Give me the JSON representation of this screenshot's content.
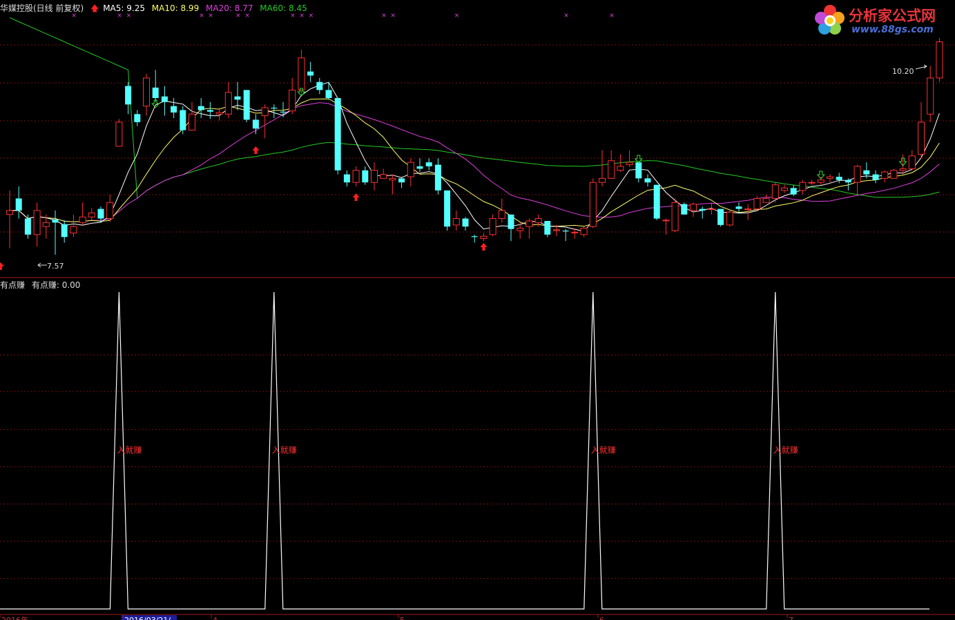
{
  "header": {
    "title": "华媒控股(日线 前复权)",
    "ma5": "MA5: 9.25",
    "ma10": "MA10: 8.99",
    "ma20": "MA20: 8.77",
    "ma60": "MA60: 8.45",
    "ma5_color": "#ffffff",
    "ma10_color": "#ffff66",
    "ma20_color": "#e040e0",
    "ma60_color": "#22cc22"
  },
  "sub_header": {
    "indicator": "有点赚",
    "value": "有点赚: 0.00"
  },
  "logo": {
    "text": "分析家公式网",
    "url": "www.88gs.com"
  },
  "annotations": {
    "high_label": "10.20",
    "low_label": "7.57",
    "signal_label": "入就赚"
  },
  "axis": {
    "labels": [
      "2016年",
      "2016/03/21/-",
      "4",
      "5",
      "6",
      "7"
    ]
  },
  "chart_data": [
    {
      "type": "candlestick",
      "title": "华媒控股(日线 前复权)",
      "ylim": [
        7.3,
        10.6
      ],
      "up_color": "#ff3030",
      "down_color": "#54ffff",
      "candles": [
        [
          8.05,
          8.1,
          8.35,
          7.63
        ],
        [
          8.25,
          8.1,
          8.4,
          8.0
        ],
        [
          8.0,
          7.8,
          8.05,
          7.75
        ],
        [
          7.8,
          8.1,
          8.2,
          7.65
        ],
        [
          7.9,
          7.95,
          8.05,
          7.75
        ],
        [
          7.99,
          7.95,
          8.1,
          7.55
        ],
        [
          7.93,
          7.77,
          7.98,
          7.7
        ],
        [
          7.82,
          7.9,
          8.05,
          7.77
        ],
        [
          7.95,
          8.02,
          8.2,
          7.92
        ],
        [
          8.02,
          8.07,
          8.13,
          7.98
        ],
        [
          8.12,
          8.0,
          8.15,
          7.95
        ],
        [
          8.0,
          8.2,
          8.3,
          7.96
        ],
        [
          8.9,
          9.2,
          9.24,
          8.9
        ],
        [
          9.65,
          9.42,
          9.7,
          9.3
        ],
        [
          9.3,
          9.2,
          9.35,
          9.15
        ],
        [
          9.4,
          9.75,
          9.8,
          9.28
        ],
        [
          9.63,
          9.5,
          9.85,
          9.45
        ],
        [
          9.52,
          9.45,
          9.65,
          9.28
        ],
        [
          9.4,
          9.32,
          9.5,
          9.25
        ],
        [
          9.35,
          9.1,
          9.4,
          9.05
        ],
        [
          9.1,
          9.3,
          9.45,
          9.1
        ],
        [
          9.4,
          9.35,
          9.5,
          9.25
        ],
        [
          9.35,
          9.33,
          9.45,
          9.24
        ],
        [
          9.3,
          9.32,
          9.38,
          9.22
        ],
        [
          9.3,
          9.57,
          9.7,
          9.25
        ],
        [
          9.52,
          9.48,
          9.7,
          9.35
        ],
        [
          9.6,
          9.23,
          9.6,
          9.2
        ],
        [
          9.23,
          9.12,
          9.3,
          9.05
        ],
        [
          9.28,
          9.38,
          9.42,
          9.0
        ],
        [
          9.38,
          9.37,
          9.42,
          9.25
        ],
        [
          9.33,
          9.32,
          9.45,
          9.26
        ],
        [
          9.34,
          9.6,
          9.75,
          9.3
        ],
        [
          9.6,
          10.0,
          10.1,
          9.55
        ],
        [
          9.83,
          9.78,
          9.95,
          9.7
        ],
        [
          9.7,
          9.6,
          9.75,
          9.55
        ],
        [
          9.6,
          9.5,
          9.7,
          9.48
        ],
        [
          9.5,
          8.6,
          9.5,
          8.55
        ],
        [
          8.55,
          8.45,
          8.6,
          8.4
        ],
        [
          8.45,
          8.6,
          8.65,
          8.4
        ],
        [
          8.6,
          8.45,
          8.65,
          8.42
        ],
        [
          8.45,
          8.6,
          8.7,
          8.35
        ],
        [
          8.5,
          8.55,
          8.62,
          8.5
        ],
        [
          8.48,
          8.5,
          8.55,
          8.3
        ],
        [
          8.5,
          8.45,
          8.52,
          8.38
        ],
        [
          8.52,
          8.7,
          8.75,
          8.4
        ],
        [
          8.65,
          8.62,
          8.75,
          8.58
        ],
        [
          8.7,
          8.65,
          8.75,
          8.6
        ],
        [
          8.67,
          8.35,
          8.75,
          8.3
        ],
        [
          8.35,
          7.9,
          8.35,
          7.85
        ],
        [
          7.92,
          8.0,
          8.1,
          7.85
        ],
        [
          8.0,
          7.9,
          8.02,
          7.85
        ],
        [
          7.78,
          7.77,
          7.8,
          7.7
        ],
        [
          7.75,
          7.78,
          7.82,
          7.72
        ],
        [
          7.8,
          8.0,
          8.05,
          7.78
        ],
        [
          8.0,
          8.1,
          8.25,
          7.95
        ],
        [
          8.05,
          7.87,
          8.05,
          7.72
        ],
        [
          7.85,
          7.88,
          7.95,
          7.75
        ],
        [
          7.9,
          7.97,
          8.0,
          7.75
        ],
        [
          7.95,
          8.0,
          8.05,
          7.9
        ],
        [
          7.97,
          7.8,
          7.97,
          7.77
        ],
        [
          7.85,
          7.86,
          7.92,
          7.78
        ],
        [
          7.85,
          7.84,
          7.87,
          7.72
        ],
        [
          7.83,
          7.83,
          7.88,
          7.75
        ],
        [
          7.8,
          7.88,
          7.9,
          7.77
        ],
        [
          7.9,
          8.45,
          8.5,
          7.88
        ],
        [
          8.45,
          8.5,
          8.85,
          8.4
        ],
        [
          8.5,
          8.72,
          8.85,
          8.5
        ],
        [
          8.6,
          8.65,
          8.8,
          8.58
        ],
        [
          8.67,
          8.7,
          8.85,
          8.64
        ],
        [
          8.7,
          8.5,
          8.7,
          8.45
        ],
        [
          8.5,
          8.45,
          8.55,
          8.4
        ],
        [
          8.42,
          8.0,
          8.42,
          7.98
        ],
        [
          7.98,
          7.98,
          8.0,
          7.8
        ],
        [
          7.85,
          8.2,
          8.25,
          7.83
        ],
        [
          8.18,
          8.05,
          8.2,
          8.05
        ],
        [
          8.1,
          8.18,
          8.2,
          8.02
        ],
        [
          8.12,
          8.1,
          8.15,
          8.0
        ],
        [
          8.12,
          8.12,
          8.2,
          8.05
        ],
        [
          8.12,
          7.92,
          8.12,
          7.9
        ],
        [
          7.92,
          8.08,
          8.1,
          7.9
        ],
        [
          8.15,
          8.12,
          8.2,
          8.08
        ],
        [
          8.12,
          8.12,
          8.18,
          7.98
        ],
        [
          8.12,
          8.25,
          8.28,
          8.1
        ],
        [
          8.2,
          8.25,
          8.3,
          8.2
        ],
        [
          8.25,
          8.42,
          8.45,
          8.2
        ],
        [
          8.35,
          8.38,
          8.42,
          8.32
        ],
        [
          8.38,
          8.3,
          8.42,
          8.28
        ],
        [
          8.35,
          8.45,
          8.48,
          8.3
        ],
        [
          8.45,
          8.45,
          8.48,
          8.42
        ],
        [
          8.45,
          8.48,
          8.52,
          8.42
        ],
        [
          8.5,
          8.52,
          8.55,
          8.45
        ],
        [
          8.52,
          8.48,
          8.57,
          8.44
        ],
        [
          8.48,
          8.45,
          8.5,
          8.35
        ],
        [
          8.45,
          8.65,
          8.67,
          8.3
        ],
        [
          8.6,
          8.55,
          8.7,
          8.5
        ],
        [
          8.55,
          8.48,
          8.6,
          8.44
        ],
        [
          8.5,
          8.58,
          8.6,
          8.45
        ],
        [
          8.5,
          8.6,
          8.62,
          8.5
        ],
        [
          8.6,
          8.62,
          8.8,
          8.55
        ],
        [
          8.62,
          8.78,
          8.85,
          8.6
        ],
        [
          8.8,
          9.2,
          9.45,
          8.75
        ],
        [
          9.3,
          9.75,
          9.9,
          9.2
        ],
        [
          9.75,
          10.2,
          10.25,
          9.7
        ]
      ]
    },
    {
      "type": "line",
      "title": "有点赚",
      "ylim": [
        0,
        1
      ],
      "series": [
        {
          "name": "有点赚",
          "color": "#ffffff",
          "spikes_at": [
            12,
            29,
            64,
            84
          ],
          "value": 0.0
        }
      ]
    }
  ]
}
